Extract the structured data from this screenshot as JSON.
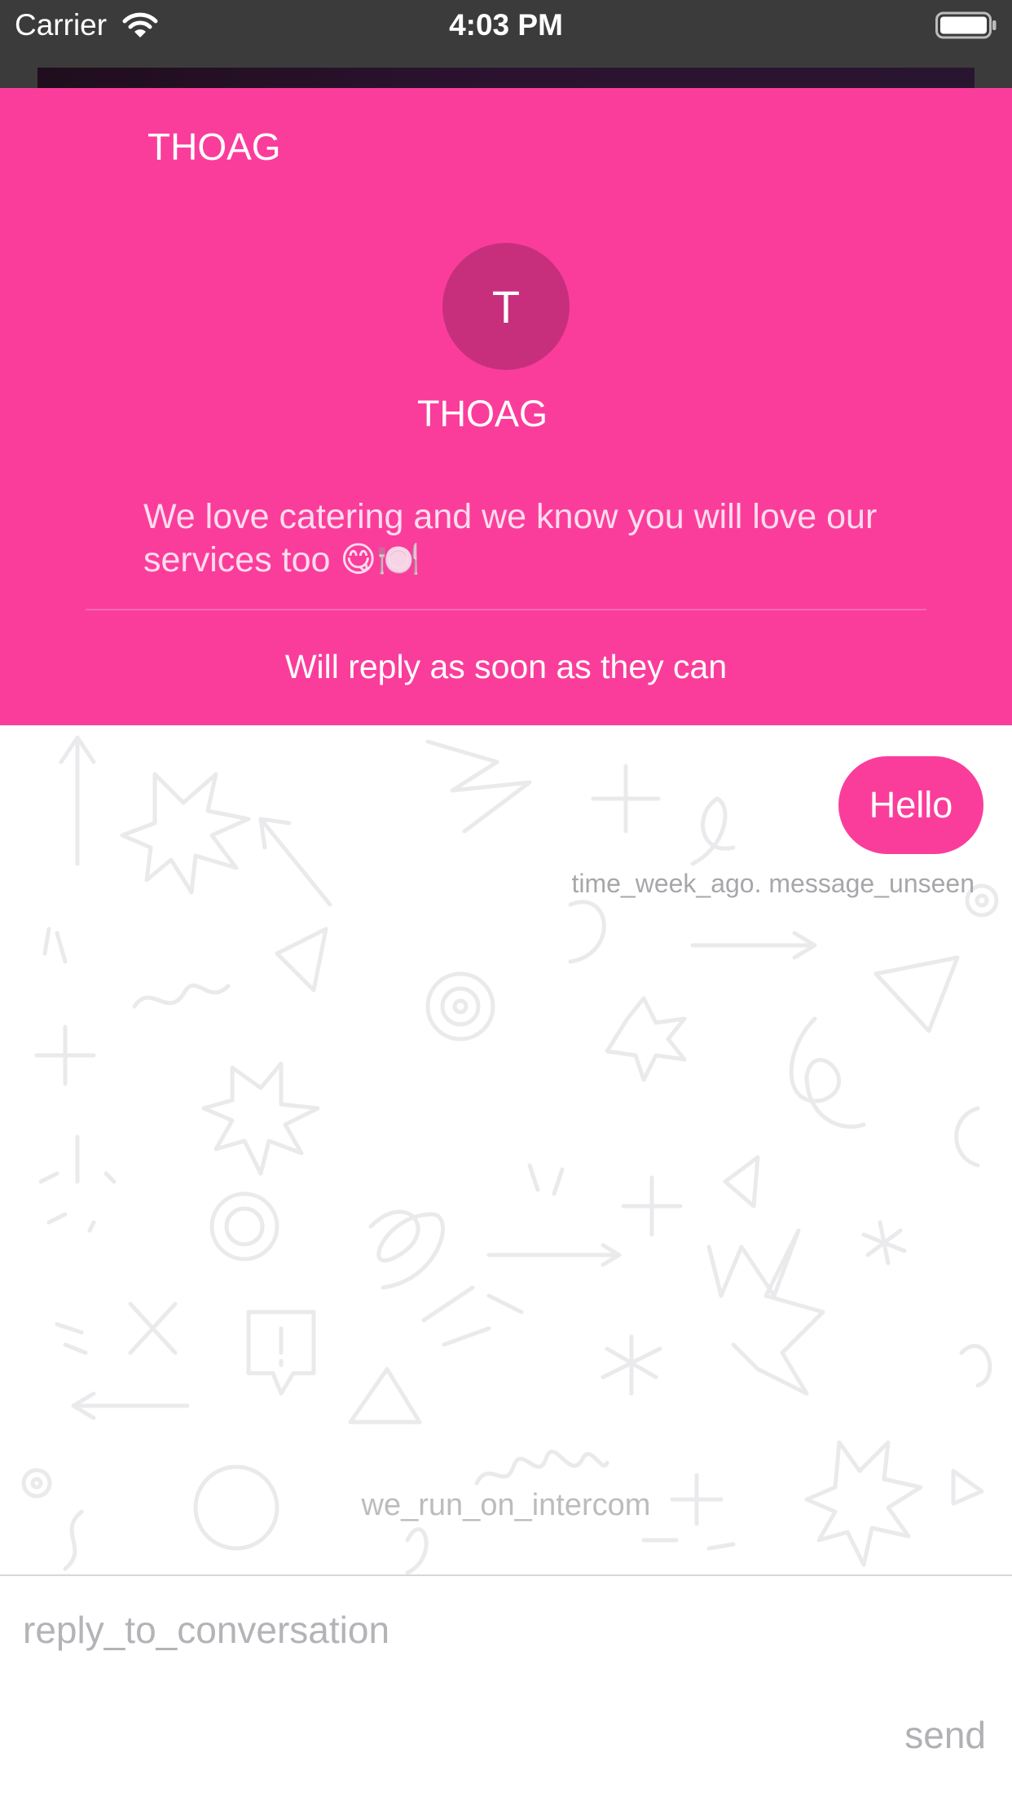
{
  "status_bar": {
    "carrier": "Carrier",
    "time": "4:03 PM",
    "wifi_icon": "wifi-icon",
    "battery_icon": "battery-icon"
  },
  "header": {
    "title": "THOAG",
    "avatar_initial": "T",
    "team_name": "THOAG",
    "intro": "We love catering and we know you will love our services too 😋🍽️",
    "reply_expectation": "Will reply as soon as they can",
    "background_color": "#fa3d9b"
  },
  "conversation": {
    "messages": [
      {
        "text": "Hello",
        "meta": "time_week_ago. message_unseen",
        "bubble_color": "#fa3d9b"
      }
    ],
    "powered_by": "we_run_on_intercom"
  },
  "composer": {
    "placeholder": "reply_to_conversation",
    "value": "",
    "send_label": "send"
  }
}
